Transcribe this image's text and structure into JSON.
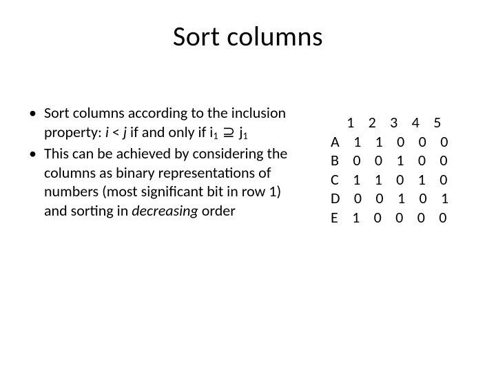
{
  "title": "Sort columns",
  "bullets": {
    "b1": {
      "t1": "Sort columns according to the inclusion property: ",
      "i": "i",
      "lt": " < ",
      "j": "j",
      "t2": " if and only if  i",
      "sub1": "1",
      "sup": " ⊇ ",
      "j2": "j",
      "sub2": "1"
    },
    "b2": {
      "t1": "This can be achieved by considering the columns as binary representations of numbers (most significant bit in row 1) and sorting in ",
      "dec": "decreasing",
      "t2": " order"
    }
  },
  "matrix": {
    "header": "1 2 3 4 5",
    "rows": [
      "A 1 1 0 0 0",
      "B 0 0 1 0 0",
      "C 1 1 0 1 0",
      "D 0 0 1 0 1",
      "E 1 0 0 0 0"
    ]
  }
}
